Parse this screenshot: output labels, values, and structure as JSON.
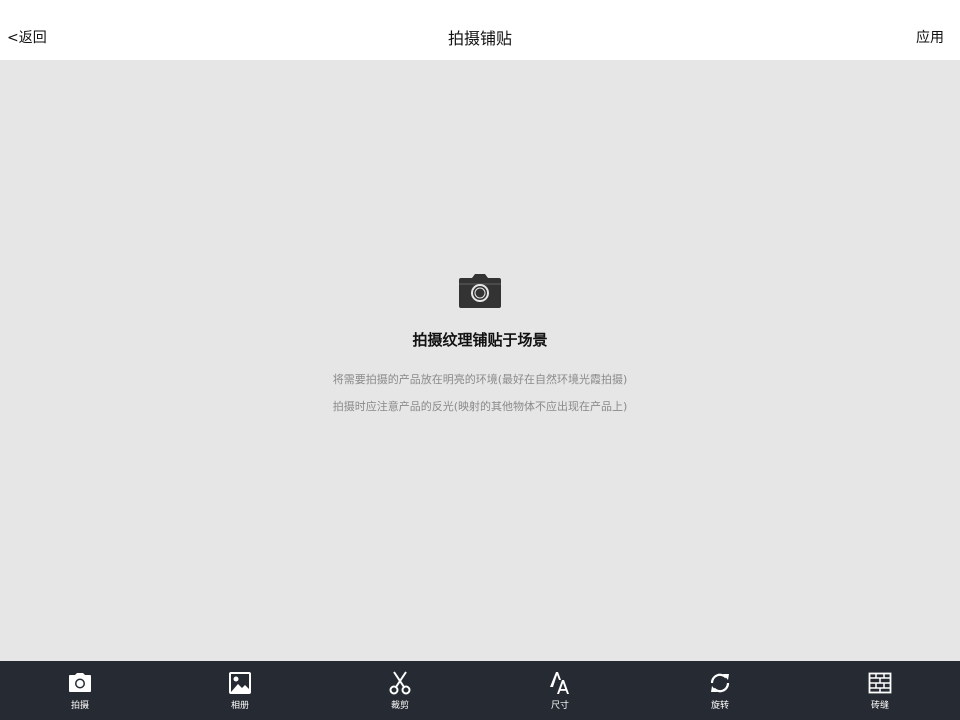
{
  "header": {
    "back_label": "<返回",
    "title": "拍摄铺贴",
    "apply_label": "应用"
  },
  "main": {
    "icon": "camera-icon",
    "heading": "拍摄纹理铺贴于场景",
    "tips": [
      "将需要拍摄的产品放在明亮的环境(最好在自然环境光霞拍摄)",
      "拍摄时应注意产品的反光(映射的其他物体不应出现在产品上)"
    ]
  },
  "toolbar": {
    "items": [
      {
        "label": "拍摄",
        "icon": "camera-icon"
      },
      {
        "label": "相册",
        "icon": "image-icon"
      },
      {
        "label": "裁剪",
        "icon": "scissors-icon"
      },
      {
        "label": "尺寸",
        "icon": "font-size-icon"
      },
      {
        "label": "旋转",
        "icon": "rotate-icon"
      },
      {
        "label": "砖缝",
        "icon": "brick-icon"
      }
    ]
  },
  "colors": {
    "header_bg": "#ffffff",
    "canvas_bg": "#e6e6e6",
    "toolbar_bg": "#262b33",
    "tip_text": "#8a8a8a"
  }
}
